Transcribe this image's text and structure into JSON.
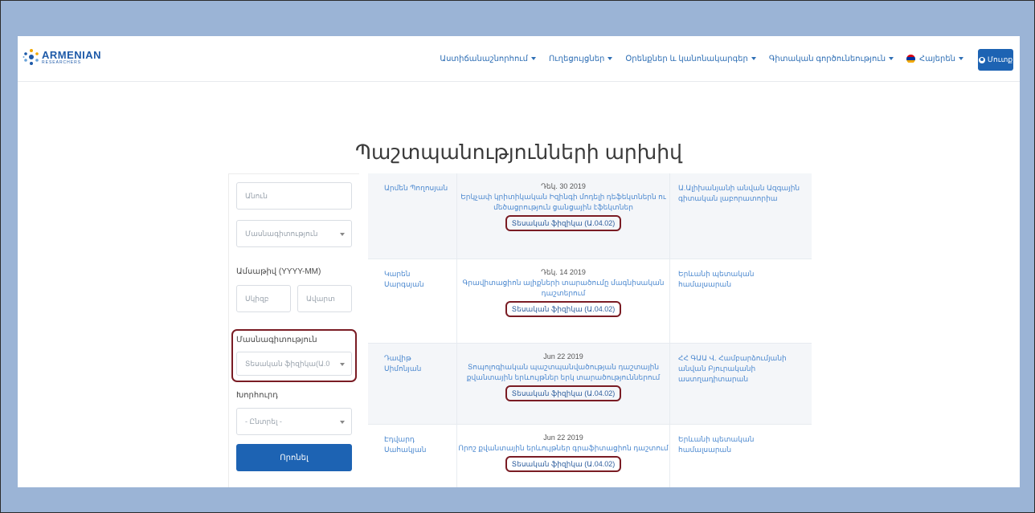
{
  "brand": {
    "logo_main": "ARMENIAN",
    "logo_sub": "RESEARCHERS"
  },
  "nav": {
    "items": [
      {
        "label": "Աստիճանաշնորհում"
      },
      {
        "label": "Ուղեցույցներ"
      },
      {
        "label": "Օրենքներ և կանոնակարգեր"
      },
      {
        "label": "Գիտական գործունեություն"
      }
    ],
    "language": "Հայերեն",
    "login_label": "Մուտք",
    "flag_colors": [
      "#d90012",
      "#0033a0",
      "#f2a800"
    ]
  },
  "page_title": "Պաշտպանությունների արխիվ",
  "filters": {
    "name_placeholder": "Անուն",
    "specialty_placeholder": "Մասնագիտություն",
    "date_label": "Ամսաթիվ (YYYY-MM)",
    "from_placeholder": "Սկիզբ",
    "to_placeholder": "Ավարտ",
    "specialty_label": "Մասնագիտություն",
    "specialty_value": "Տեսական ֆիզիկա(Ա.0",
    "council_label": "Խորհուրդ",
    "council_value": "- Ընտրել -",
    "search_label": "Որոնել"
  },
  "rows": [
    {
      "author": "Արմեն Պողոսյան",
      "date": "Դեկ. 30 2019",
      "title": "Երկչափ կրիտիկական Իզինգի մոդելի դեֆեկտներն ու մեծացրություն ցանցային էֆեկտներ",
      "specialty": "Տեսական ֆիզիկա (Ա.04.02)",
      "org": "Ա.Ալիխանյանի անվան Ազգային գիտական լաբորատորիա"
    },
    {
      "author": "Կարեն Սարգսյան",
      "date": "Դեկ. 14 2019",
      "title": "Գրավիտացիոն ալիքների տարածումը մագնիսական դաշտերում",
      "specialty": "Տեսական ֆիզիկա (Ա.04.02)",
      "org": "Երևանի պետական համալսարան"
    },
    {
      "author": "Դավիթ Սիմոնյան",
      "date": "Jun 22 2019",
      "title": "Տոպոլոգիական պաշտպանվածության դաշտային քվանտային երևույթներ երկ տարածություններում",
      "specialty": "Տեսական ֆիզիկա (Ա.04.02)",
      "org": "ՀՀ ԳԱԱ Վ. Համբարձումյանի անվան Բյուրականի աստղադիտարան"
    },
    {
      "author": "Էդվարդ Սահակյան",
      "date": "Jun 22 2019",
      "title": "Որոշ քվանտային երևույթներ գրաֆիտացիոն դաշտում",
      "specialty": "Տեսական ֆիզիկա (Ա.04.02)",
      "org": "Երևանի պետական համալսարան"
    }
  ]
}
